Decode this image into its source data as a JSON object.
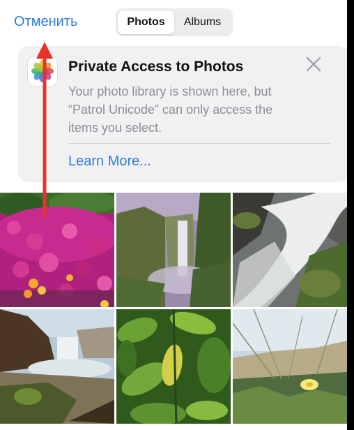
{
  "header": {
    "cancel_label": "Отменить",
    "tabs": [
      {
        "label": "Photos",
        "active": true
      },
      {
        "label": "Albums",
        "active": false
      }
    ]
  },
  "banner": {
    "title": "Private Access to Photos",
    "body": "Your photo library is shown here, but\n“Patrol Unicode” can only access the\nitems you select.",
    "link": "Learn More..."
  },
  "photos": [
    {
      "subject": "pink flowers"
    },
    {
      "subject": "waterfall valley"
    },
    {
      "subject": "waterfall rocks"
    },
    {
      "subject": "waterfall cliff"
    },
    {
      "subject": "green leaves"
    },
    {
      "subject": "beach grass"
    }
  ],
  "colors": {
    "accent": "#2f7ddb",
    "annotation_arrow": "#e8322a"
  }
}
